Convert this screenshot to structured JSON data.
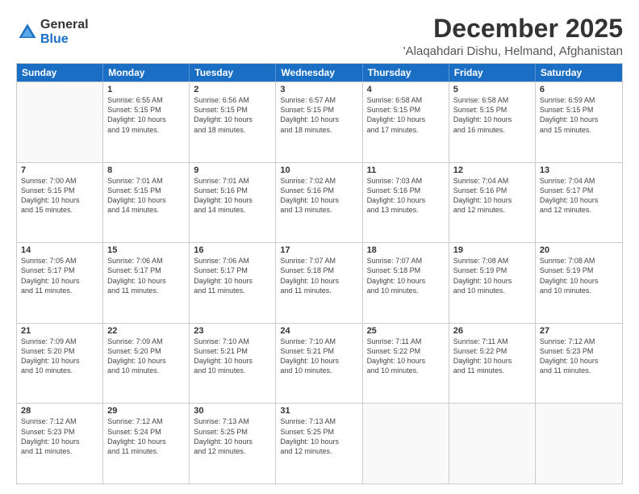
{
  "logo": {
    "general": "General",
    "blue": "Blue"
  },
  "title": "December 2025",
  "subtitle": "'Alaqahdari Dishu, Helmand, Afghanistan",
  "headers": [
    "Sunday",
    "Monday",
    "Tuesday",
    "Wednesday",
    "Thursday",
    "Friday",
    "Saturday"
  ],
  "weeks": [
    [
      {
        "day": "",
        "info": ""
      },
      {
        "day": "1",
        "info": "Sunrise: 6:55 AM\nSunset: 5:15 PM\nDaylight: 10 hours\nand 19 minutes."
      },
      {
        "day": "2",
        "info": "Sunrise: 6:56 AM\nSunset: 5:15 PM\nDaylight: 10 hours\nand 18 minutes."
      },
      {
        "day": "3",
        "info": "Sunrise: 6:57 AM\nSunset: 5:15 PM\nDaylight: 10 hours\nand 18 minutes."
      },
      {
        "day": "4",
        "info": "Sunrise: 6:58 AM\nSunset: 5:15 PM\nDaylight: 10 hours\nand 17 minutes."
      },
      {
        "day": "5",
        "info": "Sunrise: 6:58 AM\nSunset: 5:15 PM\nDaylight: 10 hours\nand 16 minutes."
      },
      {
        "day": "6",
        "info": "Sunrise: 6:59 AM\nSunset: 5:15 PM\nDaylight: 10 hours\nand 15 minutes."
      }
    ],
    [
      {
        "day": "7",
        "info": "Sunrise: 7:00 AM\nSunset: 5:15 PM\nDaylight: 10 hours\nand 15 minutes."
      },
      {
        "day": "8",
        "info": "Sunrise: 7:01 AM\nSunset: 5:15 PM\nDaylight: 10 hours\nand 14 minutes."
      },
      {
        "day": "9",
        "info": "Sunrise: 7:01 AM\nSunset: 5:16 PM\nDaylight: 10 hours\nand 14 minutes."
      },
      {
        "day": "10",
        "info": "Sunrise: 7:02 AM\nSunset: 5:16 PM\nDaylight: 10 hours\nand 13 minutes."
      },
      {
        "day": "11",
        "info": "Sunrise: 7:03 AM\nSunset: 5:16 PM\nDaylight: 10 hours\nand 13 minutes."
      },
      {
        "day": "12",
        "info": "Sunrise: 7:04 AM\nSunset: 5:16 PM\nDaylight: 10 hours\nand 12 minutes."
      },
      {
        "day": "13",
        "info": "Sunrise: 7:04 AM\nSunset: 5:17 PM\nDaylight: 10 hours\nand 12 minutes."
      }
    ],
    [
      {
        "day": "14",
        "info": "Sunrise: 7:05 AM\nSunset: 5:17 PM\nDaylight: 10 hours\nand 11 minutes."
      },
      {
        "day": "15",
        "info": "Sunrise: 7:06 AM\nSunset: 5:17 PM\nDaylight: 10 hours\nand 11 minutes."
      },
      {
        "day": "16",
        "info": "Sunrise: 7:06 AM\nSunset: 5:17 PM\nDaylight: 10 hours\nand 11 minutes."
      },
      {
        "day": "17",
        "info": "Sunrise: 7:07 AM\nSunset: 5:18 PM\nDaylight: 10 hours\nand 11 minutes."
      },
      {
        "day": "18",
        "info": "Sunrise: 7:07 AM\nSunset: 5:18 PM\nDaylight: 10 hours\nand 10 minutes."
      },
      {
        "day": "19",
        "info": "Sunrise: 7:08 AM\nSunset: 5:19 PM\nDaylight: 10 hours\nand 10 minutes."
      },
      {
        "day": "20",
        "info": "Sunrise: 7:08 AM\nSunset: 5:19 PM\nDaylight: 10 hours\nand 10 minutes."
      }
    ],
    [
      {
        "day": "21",
        "info": "Sunrise: 7:09 AM\nSunset: 5:20 PM\nDaylight: 10 hours\nand 10 minutes."
      },
      {
        "day": "22",
        "info": "Sunrise: 7:09 AM\nSunset: 5:20 PM\nDaylight: 10 hours\nand 10 minutes."
      },
      {
        "day": "23",
        "info": "Sunrise: 7:10 AM\nSunset: 5:21 PM\nDaylight: 10 hours\nand 10 minutes."
      },
      {
        "day": "24",
        "info": "Sunrise: 7:10 AM\nSunset: 5:21 PM\nDaylight: 10 hours\nand 10 minutes."
      },
      {
        "day": "25",
        "info": "Sunrise: 7:11 AM\nSunset: 5:22 PM\nDaylight: 10 hours\nand 10 minutes."
      },
      {
        "day": "26",
        "info": "Sunrise: 7:11 AM\nSunset: 5:22 PM\nDaylight: 10 hours\nand 11 minutes."
      },
      {
        "day": "27",
        "info": "Sunrise: 7:12 AM\nSunset: 5:23 PM\nDaylight: 10 hours\nand 11 minutes."
      }
    ],
    [
      {
        "day": "28",
        "info": "Sunrise: 7:12 AM\nSunset: 5:23 PM\nDaylight: 10 hours\nand 11 minutes."
      },
      {
        "day": "29",
        "info": "Sunrise: 7:12 AM\nSunset: 5:24 PM\nDaylight: 10 hours\nand 11 minutes."
      },
      {
        "day": "30",
        "info": "Sunrise: 7:13 AM\nSunset: 5:25 PM\nDaylight: 10 hours\nand 12 minutes."
      },
      {
        "day": "31",
        "info": "Sunrise: 7:13 AM\nSunset: 5:25 PM\nDaylight: 10 hours\nand 12 minutes."
      },
      {
        "day": "",
        "info": ""
      },
      {
        "day": "",
        "info": ""
      },
      {
        "day": "",
        "info": ""
      }
    ]
  ]
}
